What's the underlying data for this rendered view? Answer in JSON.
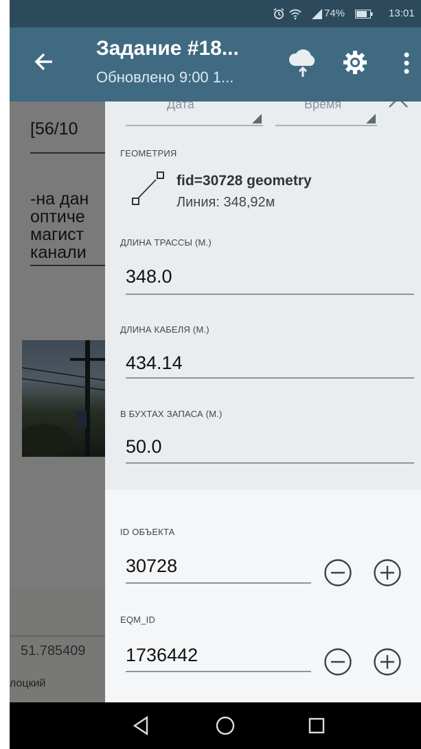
{
  "status_bar": {
    "battery": "74%",
    "time": "13:01",
    "icons": [
      "alarm-icon",
      "wifi-icon",
      "signal-icon",
      "battery-icon"
    ]
  },
  "app_bar": {
    "title": "Задание #18...",
    "subtitle": "Обновлено 9:00 1...",
    "icons": [
      "back-arrow-icon",
      "cloud-upload-icon",
      "gear-icon",
      "more-vert-icon"
    ]
  },
  "background": {
    "code": "[56/10",
    "text_lines": [
      "-на дан",
      "оптиче",
      "магист",
      "канали"
    ],
    "coordinate": "51.785409",
    "place": "лоцкий"
  },
  "dialog": {
    "date_label": "Дата",
    "time_label": "Время",
    "geometry": {
      "header": "ГЕОМЕТРИЯ",
      "name": "fid=30728 geometry",
      "length": "Линия: 348,92м"
    },
    "fields": [
      {
        "header": "ДЛИНА ТРАССЫ (М.)",
        "value": "348.0"
      },
      {
        "header": "ДЛИНА КАБЕЛЯ (М.)",
        "value": "434.14"
      },
      {
        "header": "В БУХТАХ ЗАПАСА (М.)",
        "value": "50.0"
      }
    ],
    "steppers": [
      {
        "header": "ID ОБЪЕКТА",
        "value": "30728"
      },
      {
        "header": "EQM_ID",
        "value": "1736442"
      }
    ]
  },
  "nav_bar": {
    "icons": [
      "back-triangle-icon",
      "home-circle-icon",
      "recents-square-icon"
    ]
  },
  "colors": {
    "status_bar": "#2c4a5c",
    "app_bar": "#3f6a82",
    "sheet": "#e9edf0",
    "nav_bar": "#000000"
  }
}
